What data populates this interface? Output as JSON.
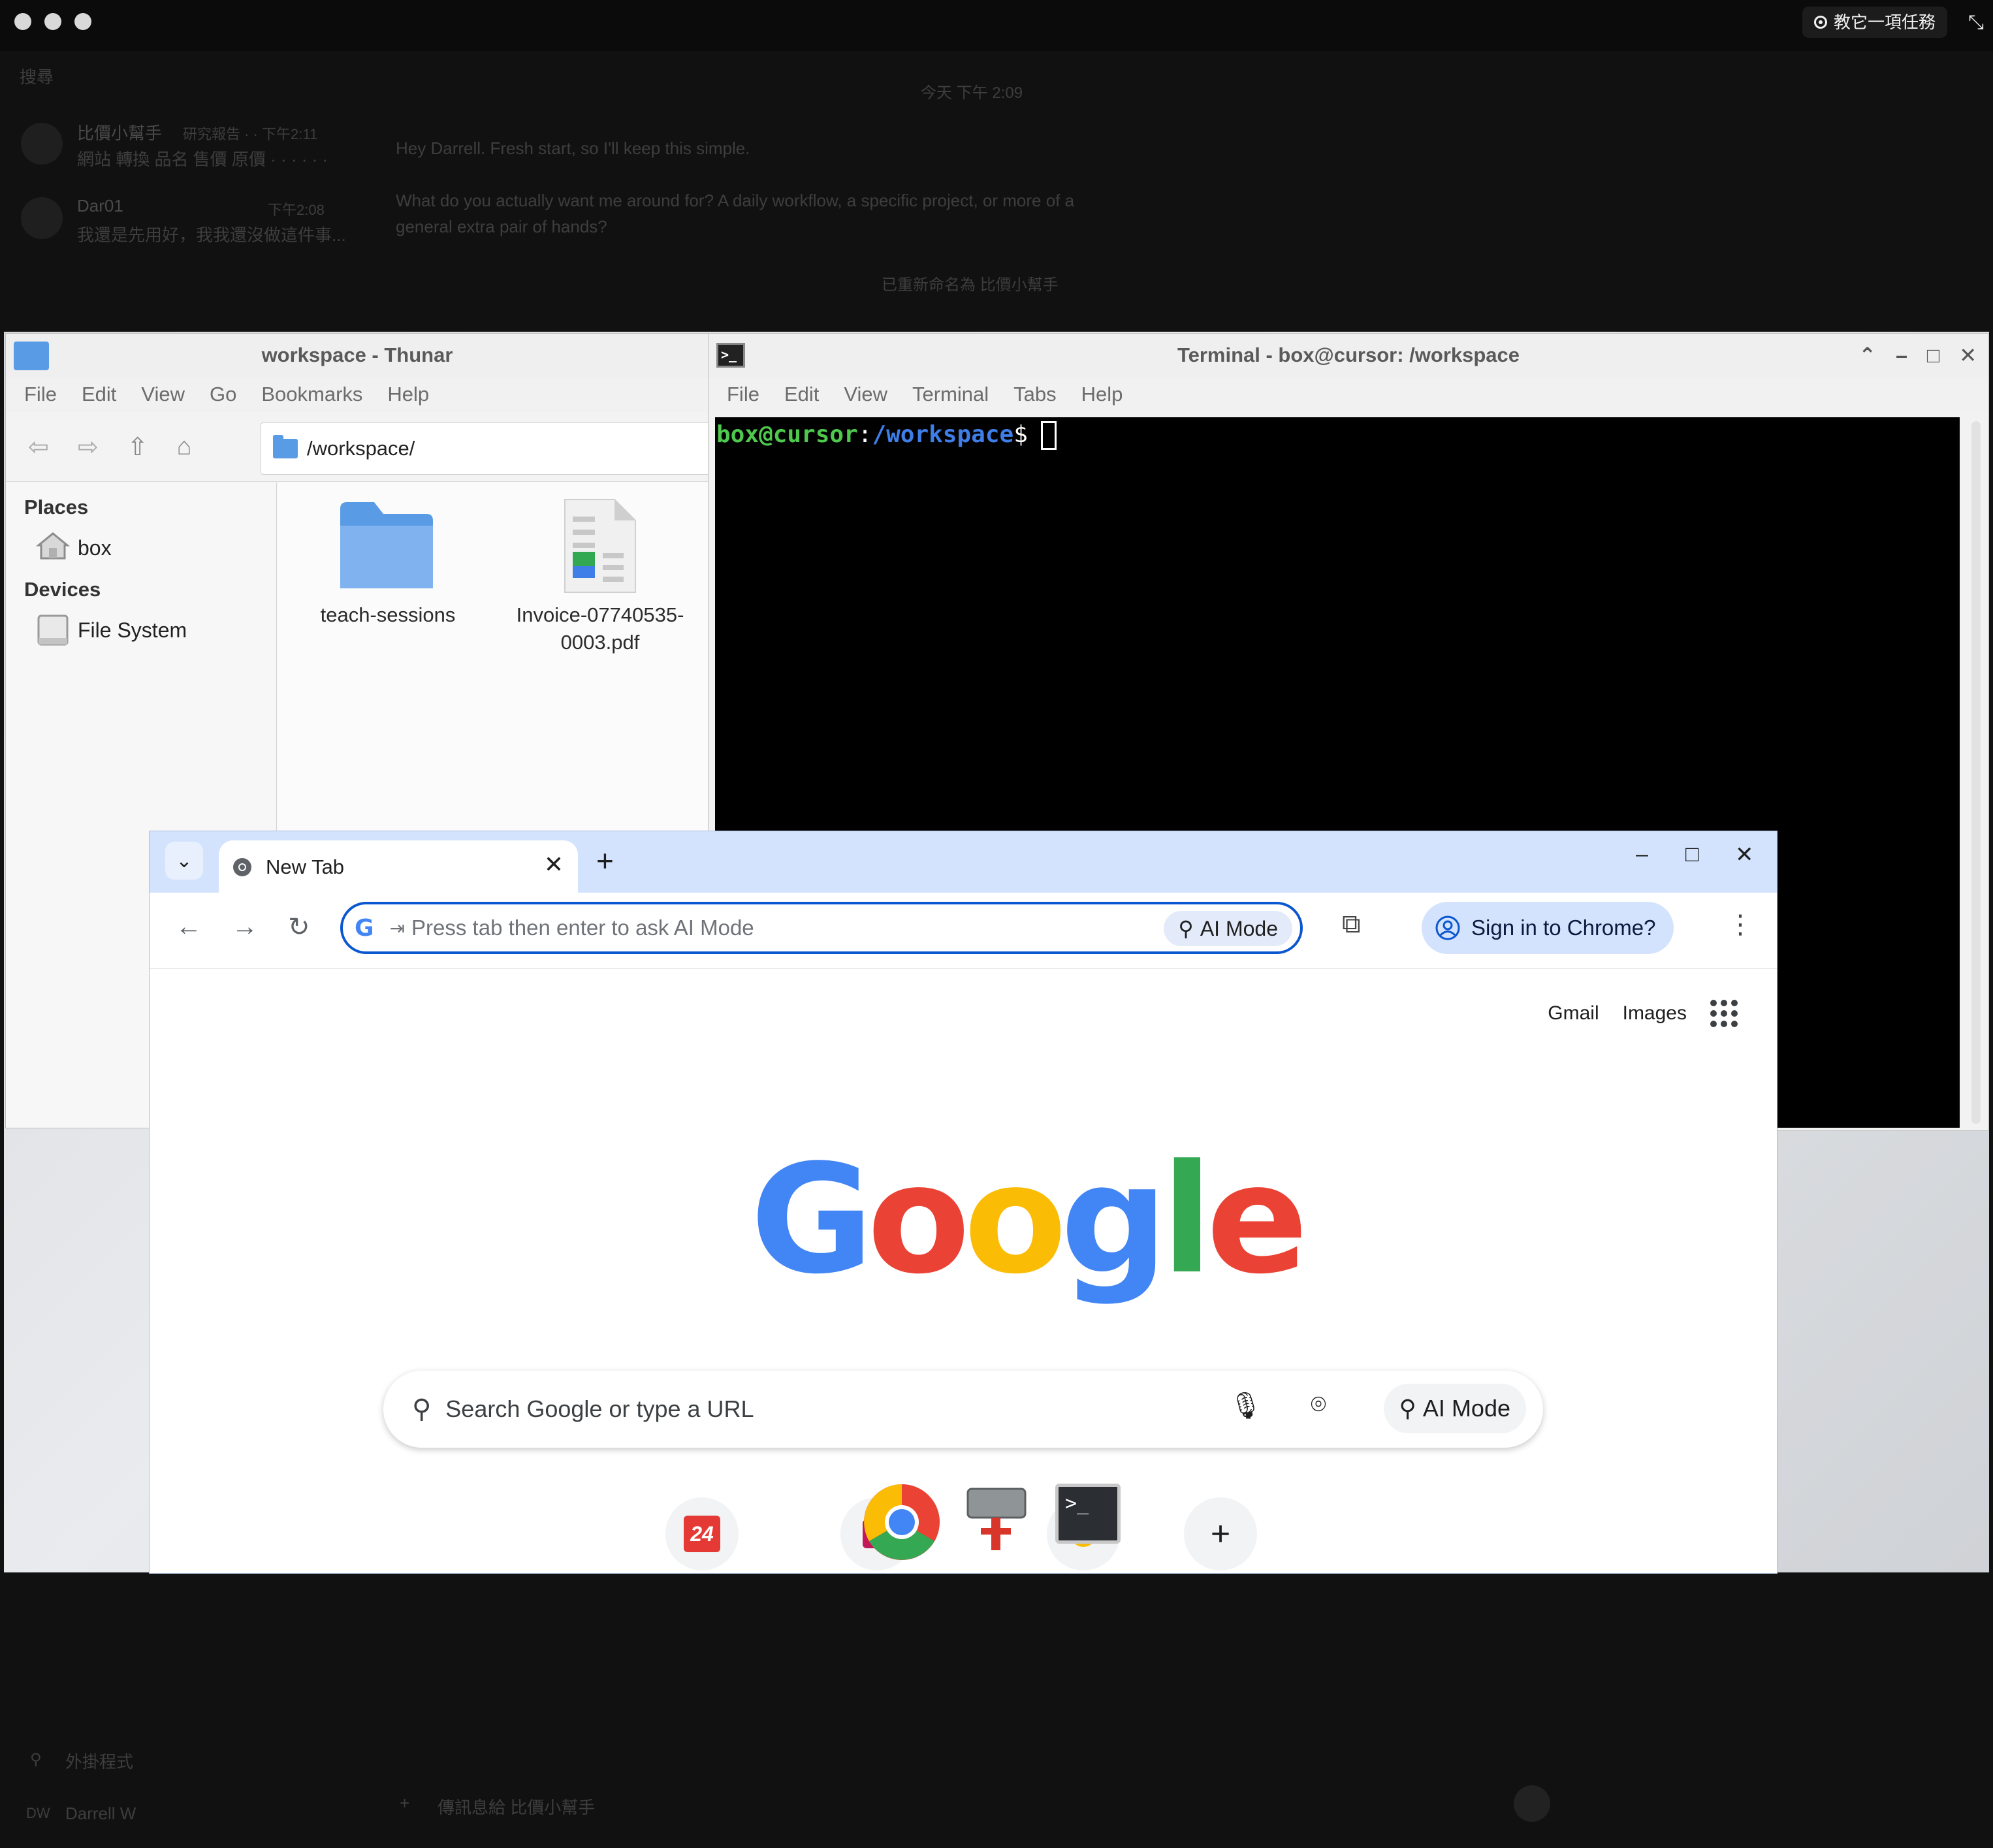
{
  "host": {
    "teach_button": "教它一項任務",
    "search_label": "搜尋",
    "date_label": "今天 下午 2:09",
    "chats": [
      {
        "name": "比價小幫手",
        "meta": "研究報告 · · 下午2:11",
        "preview": "網站 轉換 品名 售價 原價 · · · · · ·"
      },
      {
        "name": "Dar01",
        "meta": "下午2:08",
        "preview": "我還是先用好，我我還沒做這件事..."
      }
    ],
    "messages": [
      "Hey Darrell. Fresh start, so I'll keep this simple.",
      "What do you actually want me around for? A daily workflow, a specific project, or more of a",
      "general extra pair of hands?"
    ],
    "system_note": "已重新命名為 比價小幫手",
    "plugins_label": "外掛程式",
    "user_initials": "DW",
    "user_name": "Darrell W",
    "composer_placeholder": "傳訊息給 比價小幫手"
  },
  "thunar": {
    "title": "workspace - Thunar",
    "menu": [
      "File",
      "Edit",
      "View",
      "Go",
      "Bookmarks",
      "Help"
    ],
    "path": "/workspace/",
    "places_heading": "Places",
    "places": [
      "box"
    ],
    "devices_heading": "Devices",
    "devices": [
      "File System"
    ],
    "files": [
      {
        "name": "teach-sessions",
        "icon": "folder-icon"
      },
      {
        "name_line1": "Invoice-07740535-",
        "name_line2": "0003.pdf",
        "icon": "pdf-document-icon"
      }
    ],
    "folder_color": "#5a9be6"
  },
  "terminal": {
    "title": "Terminal - box@cursor: /workspace",
    "menu": [
      "File",
      "Edit",
      "View",
      "Terminal",
      "Tabs",
      "Help"
    ],
    "prompt_user": "box@cursor",
    "prompt_sep": ":",
    "prompt_path": "/workspace",
    "prompt_sign": "$",
    "user_color": "#4ec94e",
    "path_color": "#3f7ee8"
  },
  "chrome": {
    "tab_title": "New Tab",
    "omnibox_placeholder": "Press tab then enter to ask AI Mode",
    "omnibox_ai_label": "AI Mode",
    "signin_label": "Sign in to Chrome?",
    "gmail_label": "Gmail",
    "images_label": "Images",
    "logo_letters": [
      "G",
      "o",
      "o",
      "g",
      "l",
      "e"
    ],
    "logo_colors": [
      "#4285f4",
      "#ea4335",
      "#fbbc05",
      "#4285f4",
      "#34a853",
      "#ea4335"
    ],
    "search_placeholder": "Search Google or type a URL",
    "search_ai_label": "AI Mode",
    "shortcut_24_label": "24",
    "add_shortcut_label": "+",
    "accent": "#0b57d0"
  }
}
